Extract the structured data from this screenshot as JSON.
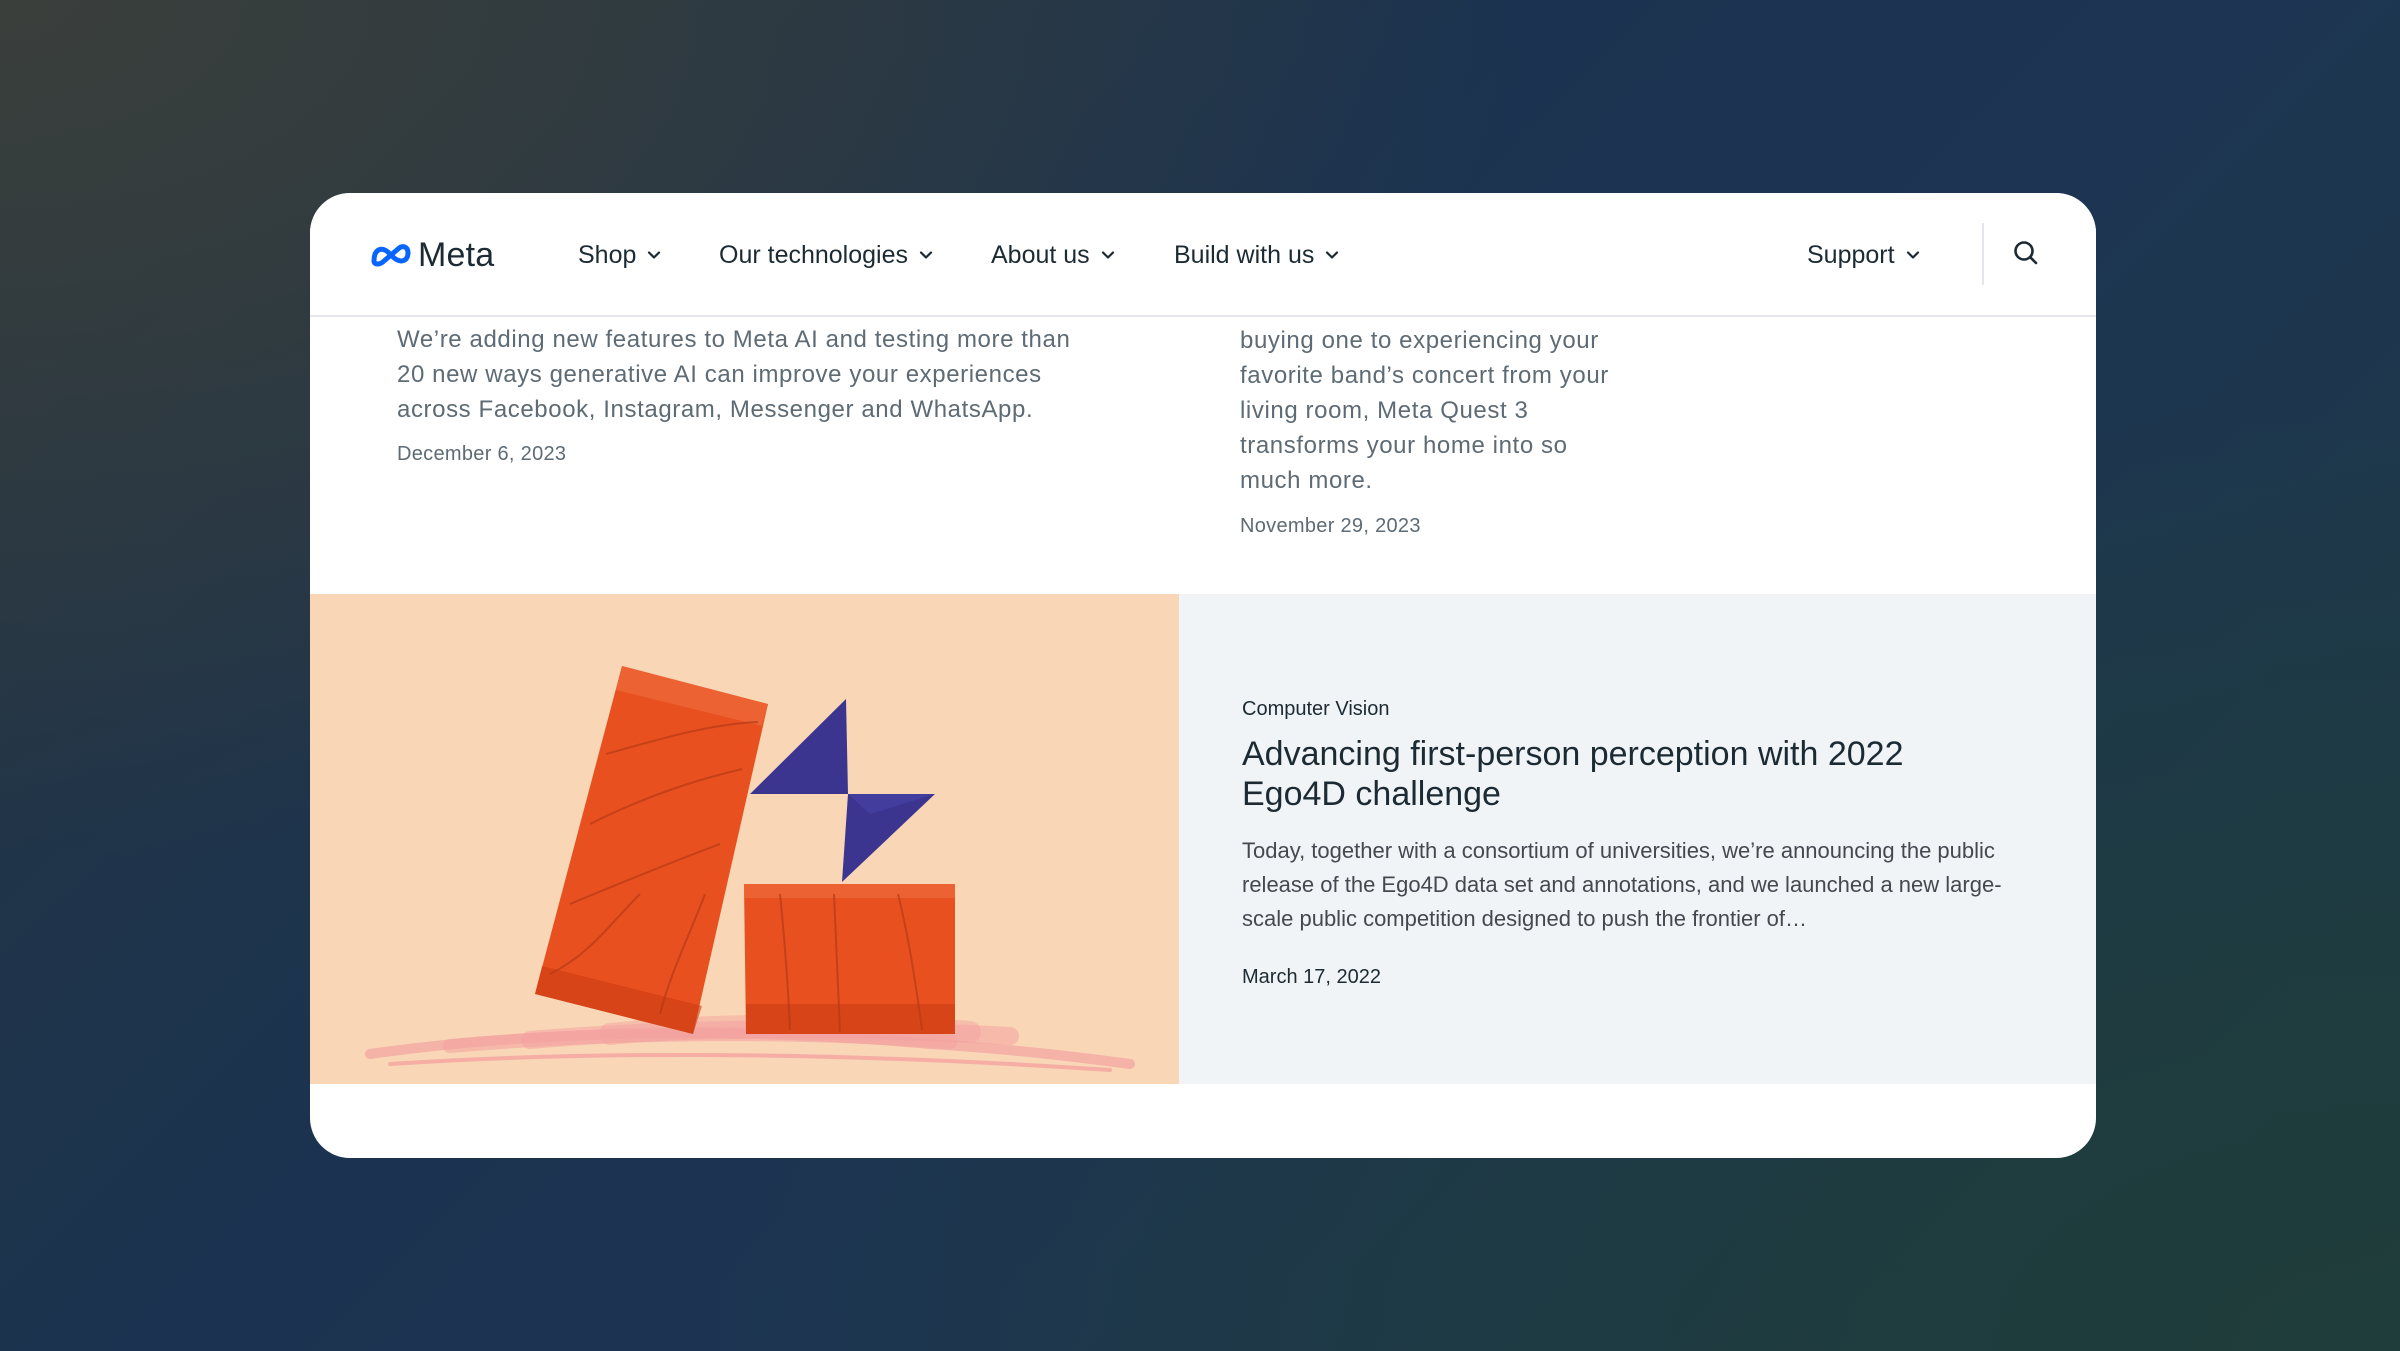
{
  "nav": {
    "logo_text": "Meta",
    "items": [
      {
        "label": "Shop"
      },
      {
        "label": "Our technologies"
      },
      {
        "label": "About us"
      },
      {
        "label": "Build with us"
      }
    ],
    "support_label": "Support",
    "search_icon": "search-icon",
    "chevron_icon": "chevron-down-icon"
  },
  "articles": [
    {
      "excerpt_lines": [
        "We’re adding new features to Meta AI and testing more than",
        "20 new ways generative AI can improve your experiences",
        "across Facebook, Instagram, Messenger and WhatsApp."
      ],
      "date": "December 6, 2023"
    },
    {
      "excerpt_lines": [
        "buying one to experiencing your",
        "favorite band’s concert from your",
        "living room, Meta Quest 3",
        "transforms your home into so",
        "much more."
      ],
      "date": "November 29, 2023"
    }
  ],
  "feature": {
    "category": "Computer Vision",
    "title": "Advancing first-person perception with 2022 Ego4D challenge",
    "excerpt": "Today, together with a consortium of universities, we’re announcing the public release of the Ego4D data set and annotations, and we launched a new large-scale public competition designed to push the frontier of…",
    "date": "March 17, 2022"
  },
  "colors": {
    "meta_blue": "#0866ff",
    "text_dark": "#1c2b33",
    "text_muted": "#5e6b74",
    "feature_image_bg": "#f9d6b6",
    "feature_card_bg": "#f1f4f7",
    "block_orange": "#e8501f",
    "triangle_purple": "#3b3590"
  }
}
